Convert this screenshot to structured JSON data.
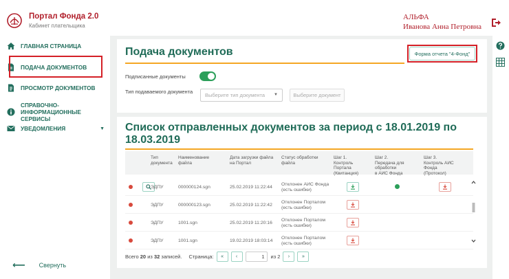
{
  "header": {
    "brand_title": "Портал Фонда 2.0",
    "brand_subtitle": "Кабинет плательщика",
    "org": "АЛЬФА",
    "user": "Иванова Анна Петровна"
  },
  "sidebar": {
    "items": [
      {
        "label": "ГЛАВНАЯ СТРАНИЦА",
        "icon": "home-icon"
      },
      {
        "label": "ПОДАЧА ДОКУМЕНТОВ",
        "icon": "document-upload-icon"
      },
      {
        "label": "ПРОСМОТР ДОКУМЕНТОВ",
        "icon": "document-view-icon"
      },
      {
        "label": "СПРАВОЧНО-ИНФОРМАЦИОННЫЕ СЕРВИСЫ",
        "label_lines": [
          "СПРАВОЧНО-",
          "ИНФОРМАЦИОННЫЕ",
          "СЕРВИСЫ"
        ],
        "icon": "info-icon"
      },
      {
        "label": "УВЕДОМЛЕНИЯ",
        "icon": "envelope-icon"
      }
    ],
    "collapse_label": "Свернуть"
  },
  "submit": {
    "title": "Подача документов",
    "report_button": "Форма отчета \"4-Фонд\"",
    "signed_label": "Подписанные документы",
    "signed_enabled": true,
    "doctype_label": "Тип подаваемого документа",
    "doctype_placeholder": "Выберите тип документа",
    "choose_button": "Выберите документ"
  },
  "sent": {
    "title": "Список отправленных документов за период с 18.01.2019 по 18.03.2019",
    "title_lines": [
      "Список отправленных документов за период с 18.01.2019 по",
      "18.03.2019"
    ],
    "columns": [
      {
        "lines": [
          "Тип",
          "документа"
        ]
      },
      {
        "lines": [
          "Наименование",
          "файла"
        ]
      },
      {
        "lines": [
          "Дата загрузки файла",
          "на Портал"
        ]
      },
      {
        "lines": [
          "Статус обработки",
          "файла"
        ]
      },
      {
        "lines": [
          "Шаг 1.",
          "Контроль",
          "Портала",
          "(Квитанция)"
        ]
      },
      {
        "lines": [
          "Шаг 2.",
          "Передача для",
          "обработки",
          "в АИС Фонда"
        ]
      },
      {
        "lines": [
          "Шаг 3.",
          "Контроль АИС",
          "Фонда",
          "(Протокол)"
        ]
      }
    ],
    "rows": [
      {
        "type": "ЭДПУ",
        "file": "000000124.sgn",
        "date": "25.02.2019 11:22:44",
        "status_lines": [
          "Отклонен АИС Фонда",
          "(есть ошибки)"
        ]
      },
      {
        "type": "ЭДПУ",
        "file": "000000123.sgn",
        "date": "25.02.2019 11:22:42",
        "status_lines": [
          "Отклонен Порталом",
          "(есть ошибки)"
        ]
      },
      {
        "type": "ЭДПУ",
        "file": "1001.sgn",
        "date": "25.02.2019 11:20:16",
        "status_lines": [
          "Отклонен Порталом",
          "(есть ошибки)"
        ]
      },
      {
        "type": "ЭДПУ",
        "file": "1001.sgn",
        "date": "19.02.2019 18:03:14",
        "status_lines": [
          "Отклонен Порталом",
          "(есть ошибки)"
        ]
      }
    ],
    "pager": {
      "total_prefix": "Всего",
      "shown": "20",
      "of": "из",
      "total": "32",
      "records": "записей.",
      "page_label": "Страница:",
      "page": "1",
      "of_pages": "из 2",
      "first": "«",
      "prev": "‹",
      "next": "›",
      "last": "»"
    }
  },
  "colors": {
    "brand": "#b01e2a",
    "accent": "#1f6b57",
    "highlight": "#d41f26",
    "orange": "#f4a623",
    "toggle_on": "#2c9f5a"
  }
}
